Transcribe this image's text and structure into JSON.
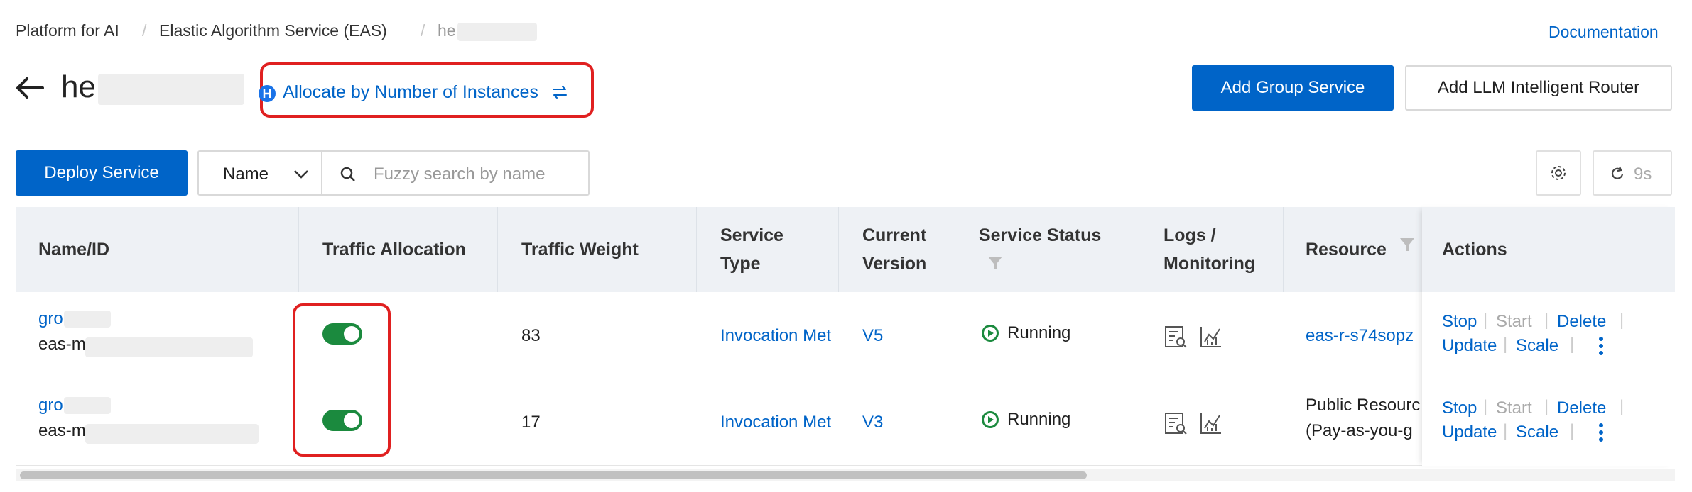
{
  "breadcrumb": {
    "items": [
      "Platform for AI",
      "Elastic Algorithm Service (EAS)",
      "he"
    ],
    "separator": "/"
  },
  "header": {
    "documentation_link": "Documentation",
    "title": "he",
    "allocate_label": "Allocate by Number of Instances",
    "add_group_button": "Add Group Service",
    "add_llm_router_button": "Add LLM Intelligent Router"
  },
  "toolbar": {
    "deploy_button": "Deploy Service",
    "filter_select": "Name",
    "search_placeholder": "Fuzzy search by name",
    "refresh_label": "9s"
  },
  "table": {
    "columns": {
      "name": "Name/ID",
      "traffic_allocation": "Traffic Allocation",
      "traffic_weight": "Traffic Weight",
      "service_type_1": "Service",
      "service_type_2": "Type",
      "current_version_1": "Current",
      "current_version_2": "Version",
      "service_status": "Service Status",
      "logs_1": "Logs /",
      "logs_2": "Monitoring",
      "resource": "Resource",
      "actions": "Actions"
    },
    "rows": [
      {
        "name": "gro",
        "id": "eas-m",
        "traffic_enabled": true,
        "weight": "83",
        "service_type": "Invocation Met",
        "version": "V5",
        "status": "Running",
        "resource_1": "eas-r-s74sopz",
        "resource_2": "",
        "actions": {
          "stop": "Stop",
          "start": "Start",
          "delete": "Delete",
          "update": "Update",
          "scale": "Scale"
        }
      },
      {
        "name": "gro",
        "id": "eas-m",
        "traffic_enabled": true,
        "weight": "17",
        "service_type": "Invocation Met",
        "version": "V3",
        "status": "Running",
        "resource_1": "Public Resourc",
        "resource_2": "(Pay-as-you-g",
        "actions": {
          "stop": "Stop",
          "start": "Start",
          "delete": "Delete",
          "update": "Update",
          "scale": "Scale"
        }
      }
    ]
  },
  "colors": {
    "primary": "#0064c8",
    "toggle_on": "#1b8a3e",
    "running": "#1b8a3e",
    "highlight": "#e02020"
  },
  "icons": [
    "back-arrow-icon",
    "allocate-switch-icon",
    "swap-arrows-icon",
    "chevron-down-icon",
    "search-icon",
    "gear-icon",
    "refresh-icon",
    "filter-icon",
    "logs-icon",
    "monitoring-icon",
    "running-icon",
    "more-icon"
  ]
}
